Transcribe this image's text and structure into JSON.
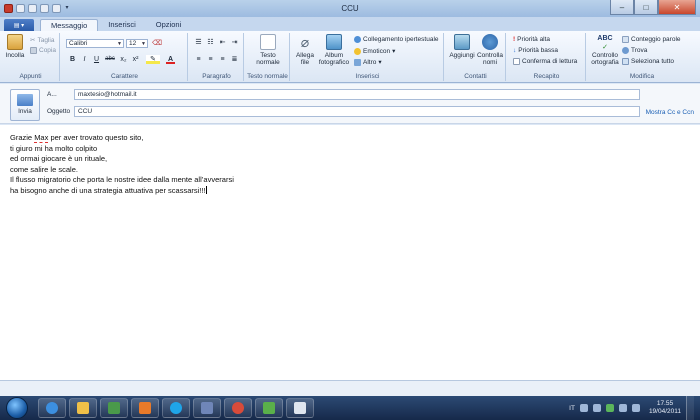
{
  "window": {
    "title": "CCU",
    "minimize_glyph": "–",
    "maximize_glyph": "□",
    "close_glyph": "✕"
  },
  "ribbon_tabs": [
    {
      "label": "Messaggio"
    },
    {
      "label": "Inserisci"
    },
    {
      "label": "Opzioni"
    }
  ],
  "ribbon": {
    "appunti": {
      "label": "Appunti",
      "paste": "Incolla",
      "cut": "Taglia",
      "copy": "Copia"
    },
    "carattere": {
      "label": "Carattere",
      "font": "Calibri",
      "size": "12",
      "bold": "B",
      "italic": "I",
      "underline": "U",
      "strike": "abc",
      "subscript": "x₂",
      "superscript": "x²",
      "font_color": "A"
    },
    "paragrafo": {
      "label": "Paragrafo"
    },
    "testo_normale": {
      "label": "Testo normale",
      "button": "Testo normale"
    },
    "inserisci": {
      "label": "Inserisci",
      "attach": "Allega file",
      "album": "Album fotografico",
      "hyperlink": "Collegamento ipertestuale",
      "emoticon": "Emoticon",
      "other": "Altro"
    },
    "contatti": {
      "label": "Contatti",
      "add": "Aggiungi",
      "check_names": "Controlla nomi"
    },
    "recapito": {
      "label": "Recapito",
      "high_priority": "Priorità alta",
      "low_priority": "Priorità bassa",
      "read_receipt": "Conferma di lettura"
    },
    "modifica": {
      "label": "Modifica",
      "spellcheck": "Controllo ortografia",
      "spellcheck_icon_text": "ABC",
      "word_count": "Conteggio parole",
      "find": "Trova",
      "select_all": "Seleziona tutto"
    }
  },
  "compose": {
    "send": "Invia",
    "to_label": "A...",
    "to_value": "maxtesio@hotmail.it",
    "subject_label": "Oggetto",
    "subject_value": "CCU",
    "show_cc_bcc": "Mostra Cc e Ccn"
  },
  "body_lines": [
    {
      "pre": "Grazie ",
      "spell": "Max",
      "post": " per aver trovato questo sito,"
    },
    {
      "pre": "ti giuro mi ha molto colpito",
      "spell": "",
      "post": ""
    },
    {
      "pre": "ed ormai giocare è un rituale,",
      "spell": "",
      "post": ""
    },
    {
      "pre": "come salire le scale.",
      "spell": "",
      "post": ""
    },
    {
      "pre": "Il flusso migratorio che porta le nostre idee dalla mente all’avverarsi",
      "spell": "",
      "post": ""
    },
    {
      "pre": "ha bisogno anche di una strategia attuativa per scassarsi!!!",
      "spell": "",
      "post": ""
    }
  ],
  "taskbar": {
    "language": "IT",
    "time": "17.55",
    "date": "19/04/2011",
    "icons": [
      "internet-explorer-icon",
      "file-explorer-icon",
      "media-center-icon",
      "media-player-icon",
      "skype-icon",
      "tool-icon",
      "chrome-icon",
      "messenger-icon",
      "mail-icon"
    ]
  },
  "colors": {
    "ribbon_bg": "#dbe6f4",
    "accent": "#1a5fb4",
    "taskbar": "#16294a"
  }
}
